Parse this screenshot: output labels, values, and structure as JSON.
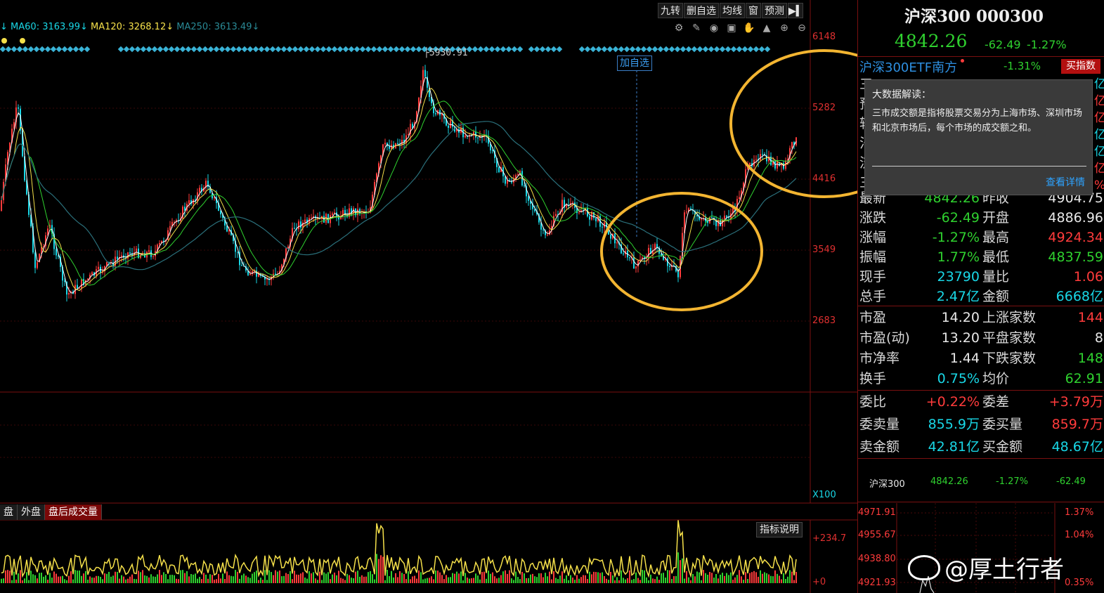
{
  "toolbar": {
    "items": [
      "九转",
      "删自选",
      "均线",
      "窗",
      "预测"
    ],
    "end_icon": "collapse-right-icon"
  },
  "ma_line": {
    "prefix": "↓",
    "ma60": "MA60: 3163.99",
    "ma60_arrow": "↓",
    "ma120": "MA120: 3268.12",
    "ma120_arrow": "↓",
    "ma250": "MA250: 3613.49",
    "ma250_arrow": "↓"
  },
  "tool_icons": [
    "settings-icon",
    "pen-icon",
    "eye-icon",
    "box-icon",
    "hand-icon",
    "lock-icon",
    "zoom-in-icon",
    "zoom-out-icon"
  ],
  "main_chart": {
    "peak_label": "5930.91",
    "add_watch_button": "加自选",
    "price_axis": [
      "6148",
      "5282",
      "4416",
      "3549",
      "2683"
    ],
    "multiplier": "X100",
    "colors": {
      "up": "#ff3b3b",
      "down": "#19d7e6",
      "ma5": "#ffffff",
      "ma10": "#f5e04a",
      "ma20": "#2fd12f",
      "ma60": "#2a6f7a",
      "highlight": "#f3b531"
    }
  },
  "volume": {
    "tabs": [
      "盘",
      "外盘",
      "盘后成交量"
    ],
    "active_tab": "盘后成交量",
    "indicator_button": "指标说明",
    "axis": [
      "+234.7",
      "+0"
    ]
  },
  "right_panel": {
    "title": "沪深300 000300",
    "price": "4842.26",
    "change": "-62.49",
    "change_pct": "-1.27%",
    "etf_name": "沪深300ETF南方",
    "etf_pct": "-1.31%",
    "buy_button": "买指数",
    "partial_rows": [
      "三",
      "预",
      "转",
      "法",
      "流",
      "三"
    ],
    "side_marks": [
      "亿",
      "亿",
      "亿",
      "亿",
      "亿",
      "亿",
      "%"
    ],
    "quote_rows": [
      {
        "l1": "最新",
        "v1": "4842.26",
        "l2": "昨收",
        "v2": "4904.75"
      },
      {
        "l1": "涨跌",
        "v1": "-62.49",
        "l2": "开盘",
        "v2": "4886.96"
      },
      {
        "l1": "涨幅",
        "v1": "-1.27%",
        "l2": "最高",
        "v2": "4924.34"
      },
      {
        "l1": "振幅",
        "v1": "1.77%",
        "l2": "最低",
        "v2": "4837.59"
      },
      {
        "l1": "现手",
        "v1": "23790",
        "l2": "量比",
        "v2": "1.06"
      },
      {
        "l1": "总手",
        "v1": "2.47亿",
        "l2": "金额",
        "v2": "6668亿"
      }
    ],
    "stat_rows": [
      {
        "l1": "市盈",
        "v1": "14.20",
        "l2": "上涨家数",
        "v2": "144"
      },
      {
        "l1": "市盈(动)",
        "v1": "13.20",
        "l2": "平盘家数",
        "v2": "8"
      },
      {
        "l1": "市净率",
        "v1": "1.44",
        "l2": "下跌家数",
        "v2": "148"
      },
      {
        "l1": "换手",
        "v1": "0.75%",
        "l2": "均价",
        "v2": "62.91"
      }
    ],
    "order_rows": [
      {
        "l1": "委比",
        "v1": "+0.22%",
        "l2": "委差",
        "v2": "+3.79万"
      },
      {
        "l1": "委卖量",
        "v1": "855.9万",
        "l2": "委买量",
        "v2": "859.7万"
      },
      {
        "l1": "卖金额",
        "v1": "42.81亿",
        "l2": "买金额",
        "v2": "48.67亿"
      }
    ],
    "mini_ticker": {
      "name": "沪深300",
      "price": "4842.26",
      "pct": "-1.27%",
      "chg": "-62.49"
    },
    "intraday_axis_left": [
      "4971.91",
      "4955.67",
      "4938.80",
      "4921.93"
    ],
    "intraday_axis_right": [
      "1.37%",
      "1.04%",
      "0.35%"
    ]
  },
  "tooltip": {
    "title": "大数据解读：",
    "body": "三市成交额是指将股票交易分为上海市场、深圳市场和北京市场后，每个市场的成交额之和。",
    "link": "查看详情"
  },
  "watermark": "@厚土行者"
}
